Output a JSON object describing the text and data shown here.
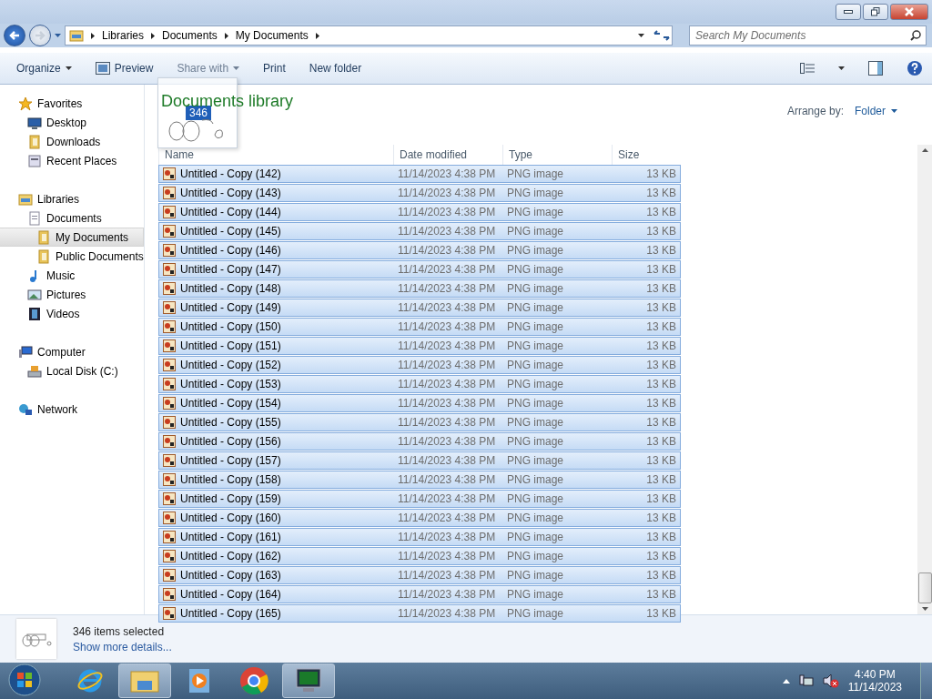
{
  "window": {
    "breadcrumb": [
      "Libraries",
      "Documents",
      "My Documents"
    ],
    "search": {
      "placeholder": "Search My Documents"
    }
  },
  "toolbar": {
    "items": [
      {
        "label": "Organize",
        "kind": "menu",
        "disabled": false
      },
      {
        "label": "Preview",
        "kind": "icon",
        "disabled": false
      },
      {
        "label": "Share with",
        "kind": "menu",
        "disabled": true
      },
      {
        "label": "Print",
        "kind": "plain",
        "disabled": false
      },
      {
        "label": "New folder",
        "kind": "plain",
        "disabled": false
      }
    ]
  },
  "sidebar": {
    "groups": [
      {
        "label": "Favorites",
        "children": [
          {
            "label": "Desktop",
            "selected": false
          },
          {
            "label": "Downloads",
            "selected": false
          },
          {
            "label": "Recent Places",
            "selected": false
          }
        ]
      },
      {
        "label": "Libraries",
        "children": [
          {
            "label": "Documents",
            "selected": false,
            "children": [
              {
                "label": "My Documents",
                "selected": true
              },
              {
                "label": "Public Documents",
                "selected": false
              }
            ]
          },
          {
            "label": "Music",
            "selected": false
          },
          {
            "label": "Pictures",
            "selected": false
          },
          {
            "label": "Videos",
            "selected": false
          }
        ]
      },
      {
        "label": "Computer",
        "children": [
          {
            "label": "Local Disk (C:)",
            "selected": false
          }
        ]
      },
      {
        "label": "Network"
      }
    ]
  },
  "library": {
    "title": "Documents library",
    "arrange_label": "Arrange by:",
    "arrange_value": "Folder"
  },
  "drag": {
    "count": "346"
  },
  "table": {
    "columns": [
      "Name",
      "Date modified",
      "Type",
      "Size"
    ],
    "rows": [
      {
        "name": "Untitled - Copy (142)",
        "date": "11/14/2023 4:38 PM",
        "type": "PNG image",
        "size": "13 KB",
        "selected": true
      },
      {
        "name": "Untitled - Copy (143)",
        "date": "11/14/2023 4:38 PM",
        "type": "PNG image",
        "size": "13 KB",
        "selected": true
      },
      {
        "name": "Untitled - Copy (144)",
        "date": "11/14/2023 4:38 PM",
        "type": "PNG image",
        "size": "13 KB",
        "selected": true
      },
      {
        "name": "Untitled - Copy (145)",
        "date": "11/14/2023 4:38 PM",
        "type": "PNG image",
        "size": "13 KB",
        "selected": true
      },
      {
        "name": "Untitled - Copy (146)",
        "date": "11/14/2023 4:38 PM",
        "type": "PNG image",
        "size": "13 KB",
        "selected": true
      },
      {
        "name": "Untitled - Copy (147)",
        "date": "11/14/2023 4:38 PM",
        "type": "PNG image",
        "size": "13 KB",
        "selected": true
      },
      {
        "name": "Untitled - Copy (148)",
        "date": "11/14/2023 4:38 PM",
        "type": "PNG image",
        "size": "13 KB",
        "selected": true
      },
      {
        "name": "Untitled - Copy (149)",
        "date": "11/14/2023 4:38 PM",
        "type": "PNG image",
        "size": "13 KB",
        "selected": true
      },
      {
        "name": "Untitled - Copy (150)",
        "date": "11/14/2023 4:38 PM",
        "type": "PNG image",
        "size": "13 KB",
        "selected": true
      },
      {
        "name": "Untitled - Copy (151)",
        "date": "11/14/2023 4:38 PM",
        "type": "PNG image",
        "size": "13 KB",
        "selected": true
      },
      {
        "name": "Untitled - Copy (152)",
        "date": "11/14/2023 4:38 PM",
        "type": "PNG image",
        "size": "13 KB",
        "selected": true
      },
      {
        "name": "Untitled - Copy (153)",
        "date": "11/14/2023 4:38 PM",
        "type": "PNG image",
        "size": "13 KB",
        "selected": true
      },
      {
        "name": "Untitled - Copy (154)",
        "date": "11/14/2023 4:38 PM",
        "type": "PNG image",
        "size": "13 KB",
        "selected": true
      },
      {
        "name": "Untitled - Copy (155)",
        "date": "11/14/2023 4:38 PM",
        "type": "PNG image",
        "size": "13 KB",
        "selected": true
      },
      {
        "name": "Untitled - Copy (156)",
        "date": "11/14/2023 4:38 PM",
        "type": "PNG image",
        "size": "13 KB",
        "selected": true
      },
      {
        "name": "Untitled - Copy (157)",
        "date": "11/14/2023 4:38 PM",
        "type": "PNG image",
        "size": "13 KB",
        "selected": true
      },
      {
        "name": "Untitled - Copy (158)",
        "date": "11/14/2023 4:38 PM",
        "type": "PNG image",
        "size": "13 KB",
        "selected": true
      },
      {
        "name": "Untitled - Copy (159)",
        "date": "11/14/2023 4:38 PM",
        "type": "PNG image",
        "size": "13 KB",
        "selected": true
      },
      {
        "name": "Untitled - Copy (160)",
        "date": "11/14/2023 4:38 PM",
        "type": "PNG image",
        "size": "13 KB",
        "selected": true
      },
      {
        "name": "Untitled - Copy (161)",
        "date": "11/14/2023 4:38 PM",
        "type": "PNG image",
        "size": "13 KB",
        "selected": true
      },
      {
        "name": "Untitled - Copy (162)",
        "date": "11/14/2023 4:38 PM",
        "type": "PNG image",
        "size": "13 KB",
        "selected": true
      },
      {
        "name": "Untitled - Copy (163)",
        "date": "11/14/2023 4:38 PM",
        "type": "PNG image",
        "size": "13 KB",
        "selected": true
      },
      {
        "name": "Untitled - Copy (164)",
        "date": "11/14/2023 4:38 PM",
        "type": "PNG image",
        "size": "13 KB",
        "selected": true
      },
      {
        "name": "Untitled - Copy (165)",
        "date": "11/14/2023 4:38 PM",
        "type": "PNG image",
        "size": "13 KB",
        "selected": true
      }
    ]
  },
  "details": {
    "summary": "346 items selected",
    "link": "Show more details..."
  },
  "taskbar": {
    "apps": [
      {
        "selected": false
      },
      {
        "selected": true
      },
      {
        "selected": false
      },
      {
        "selected": false
      },
      {
        "selected": true
      }
    ],
    "time": "4:40 PM",
    "date": "11/14/2023"
  }
}
